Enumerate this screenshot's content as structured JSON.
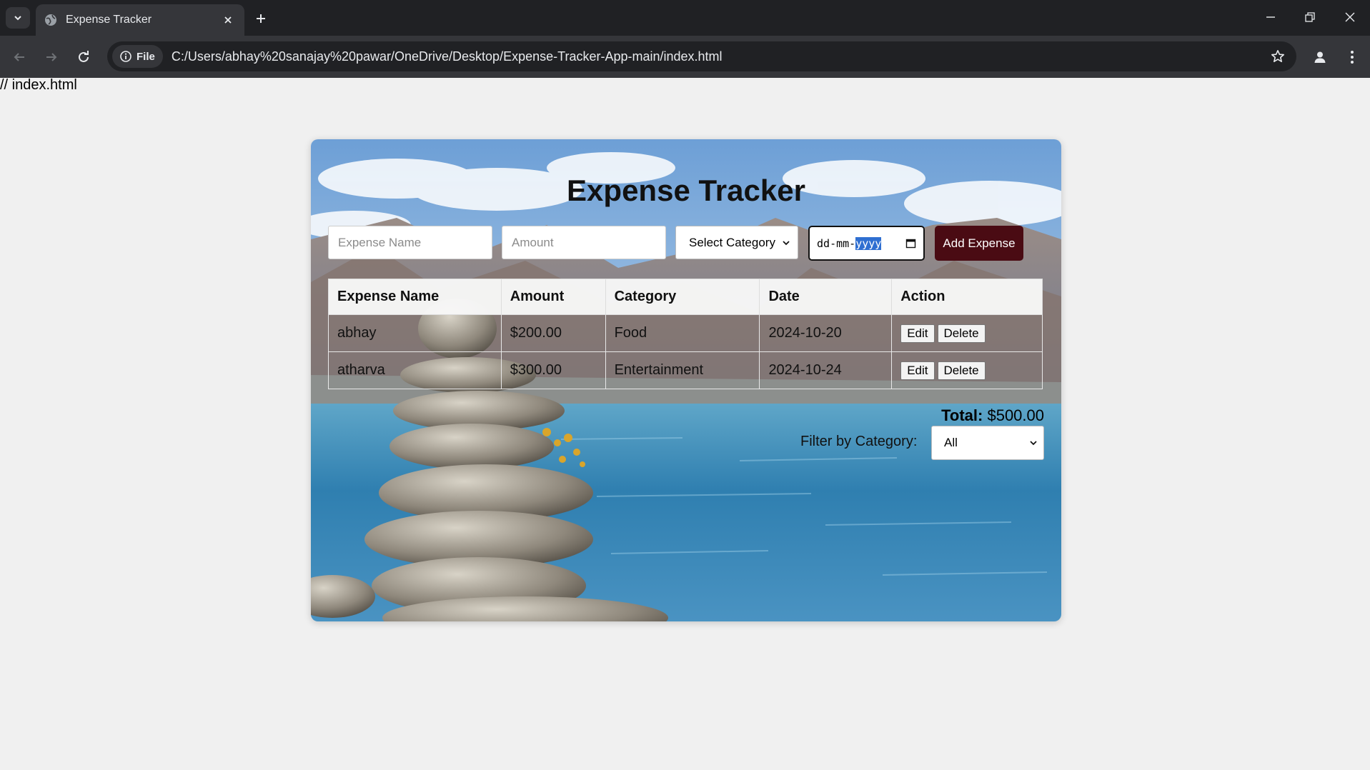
{
  "browser": {
    "tab_title": "Expense Tracker",
    "site_chip": "File",
    "url": "C:/Users/abhay%20sanajay%20pawar/OneDrive/Desktop/Expense-Tracker-App-main/index.html",
    "icons": [
      "tab-search-icon",
      "globe-icon",
      "close-icon",
      "plus-icon",
      "minimize-icon",
      "restore-icon",
      "close-window-icon",
      "back-icon",
      "forward-icon",
      "reload-icon",
      "info-icon",
      "star-icon",
      "profile-icon",
      "more-icon"
    ]
  },
  "page": {
    "comment": "// index.html"
  },
  "app": {
    "title": "Expense Tracker",
    "form": {
      "name_placeholder": "Expense Name",
      "amount_placeholder": "Amount",
      "category_selected": "Select Category",
      "date_dd": "dd",
      "date_mm": "mm",
      "date_yyyy": "yyyy",
      "date_sep": "-",
      "add_label": "Add Expense"
    },
    "table": {
      "headers": [
        "Expense Name",
        "Amount",
        "Category",
        "Date",
        "Action"
      ],
      "rows": [
        {
          "name": "abhay",
          "amount": "$200.00",
          "category": "Food",
          "date": "2024-10-20",
          "edit": "Edit",
          "delete": "Delete"
        },
        {
          "name": "atharva",
          "amount": "$300.00",
          "category": "Entertainment",
          "date": "2024-10-24",
          "edit": "Edit",
          "delete": "Delete"
        }
      ]
    },
    "total_label": "Total:",
    "total_value": "$500.00",
    "filter_label": "Filter by Category:",
    "filter_selected": "All",
    "accent_color": "#4a0b13"
  }
}
